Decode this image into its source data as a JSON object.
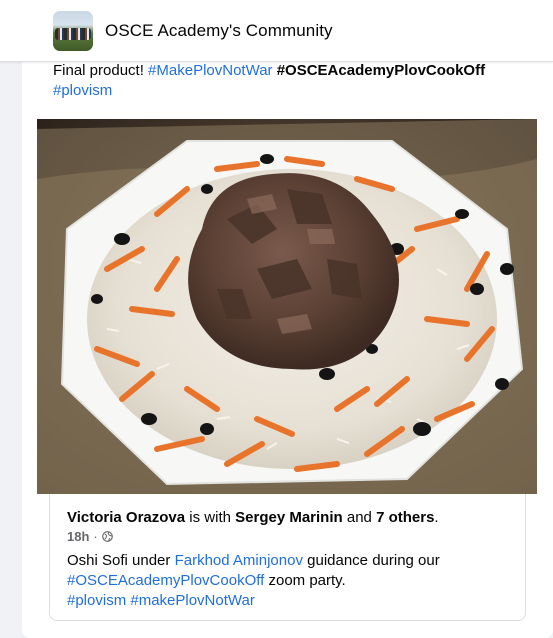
{
  "header": {
    "group_name": "OSCE Academy's Community",
    "avatar_icon": "group-photo-avatar"
  },
  "post": {
    "text_prefix": "Final product! ",
    "hashtag_1": "#MakePlovNotWar",
    "hashtag_2": "#OSCEAcademyPlovCookOff",
    "hashtag_3": "#plovism",
    "photo_icon": "plov-dish-photo"
  },
  "shared": {
    "author": "Victoria Orazova",
    "is_with": " is with ",
    "tagged": "Sergey Marinin",
    "and": " and ",
    "others": "7 others",
    "period": ".",
    "time": "18h",
    "separator": " · ",
    "privacy_icon": "globe-icon",
    "body_prefix": "Oshi Sofi under ",
    "mention": "Farkhod Aminjonov",
    "body_middle": "  guidance during our ",
    "hashtag_cookoff": "#OSCEAcademyPlovCookOff",
    "body_suffix": " zoom party.",
    "hashtag_plovism": "#plovism",
    "hashtag_makeplov": "#makePlovNotWar"
  },
  "colors": {
    "link": "#216fdb",
    "background": "#f0f2f5",
    "meta": "#65676b"
  }
}
